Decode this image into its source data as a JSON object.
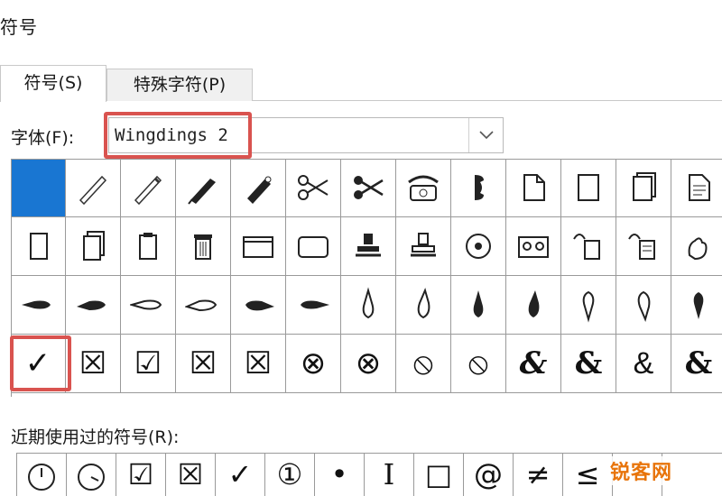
{
  "window": {
    "title": "符号"
  },
  "tabs": [
    {
      "label": "符号(S)",
      "active": true
    },
    {
      "label": "特殊字符(P)",
      "active": false
    }
  ],
  "font": {
    "label": "字体(F):",
    "value": "Wingdings 2"
  },
  "symbol_grid": {
    "rows": [
      [
        "selected-blank",
        "pencil",
        "pencil",
        "pen",
        "pen",
        "scissors",
        "scissors",
        "telephone",
        "handset",
        "document",
        "blank-page",
        "documents",
        "document-text"
      ],
      [
        "blank-page",
        "documents",
        "clipboard",
        "trash-can",
        "window",
        "window",
        "stamp",
        "stamp",
        "target",
        "tape",
        "tag",
        "tag",
        "hand-ok"
      ],
      [
        "hand-left",
        "hand-left",
        "hand-left",
        "hand-left",
        "hand-right",
        "hand-right",
        "hand-up",
        "hand-up",
        "hand-up",
        "hand-up",
        "hand-up",
        "hand-up",
        "hand-up"
      ],
      [
        "✓",
        "☒",
        "☑",
        "☒",
        "☒",
        "⊗",
        "⊗",
        "⦸",
        "⦸",
        "&",
        "&",
        "&",
        "&"
      ]
    ],
    "selected_cell": "check-mark"
  },
  "recent": {
    "label": "近期使用过的符号(R):",
    "items": [
      "clock",
      "clock",
      "☑",
      "☒",
      "✓",
      "①",
      "•",
      "I",
      "□",
      "@",
      "≠",
      "≤",
      ""
    ]
  },
  "watermark": "锐客网",
  "colors": {
    "selected": "#1976d2",
    "highlight": "#d9534f",
    "watermark": "#e8740a"
  }
}
